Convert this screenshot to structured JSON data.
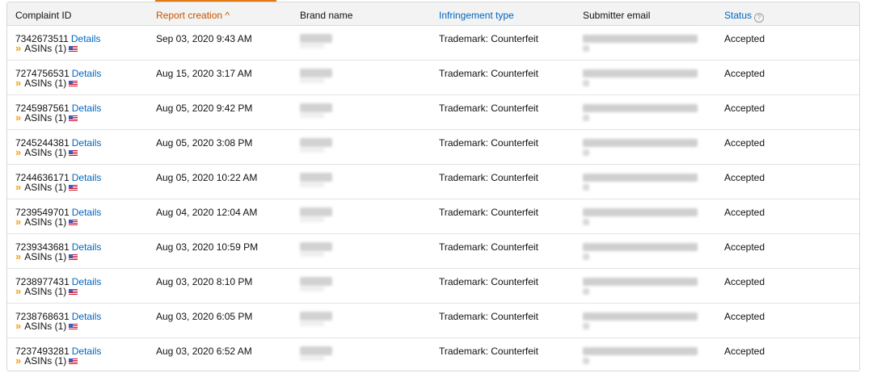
{
  "header": {
    "complaint_id": "Complaint ID",
    "report_creation": "Report creation ^",
    "brand_name": "Brand name",
    "infringement_type": "Infringement type",
    "submitter_email": "Submitter email",
    "status": "Status",
    "status_help": "?"
  },
  "details_label": "Details",
  "asin_label": "ASINs (1)",
  "rows": [
    {
      "id": "7342673511",
      "date": "Sep 03, 2020 9:43 AM",
      "type": "Trademark: Counterfeit",
      "status": "Accepted"
    },
    {
      "id": "7274756531",
      "date": "Aug 15, 2020 3:17 AM",
      "type": "Trademark: Counterfeit",
      "status": "Accepted"
    },
    {
      "id": "7245987561",
      "date": "Aug 05, 2020 9:42 PM",
      "type": "Trademark: Counterfeit",
      "status": "Accepted"
    },
    {
      "id": "7245244381",
      "date": "Aug 05, 2020 3:08 PM",
      "type": "Trademark: Counterfeit",
      "status": "Accepted"
    },
    {
      "id": "7244636171",
      "date": "Aug 05, 2020 10:22 AM",
      "type": "Trademark: Counterfeit",
      "status": "Accepted"
    },
    {
      "id": "7239549701",
      "date": "Aug 04, 2020 12:04 AM",
      "type": "Trademark: Counterfeit",
      "status": "Accepted"
    },
    {
      "id": "7239343681",
      "date": "Aug 03, 2020 10:59 PM",
      "type": "Trademark: Counterfeit",
      "status": "Accepted"
    },
    {
      "id": "7238977431",
      "date": "Aug 03, 2020 8:10 PM",
      "type": "Trademark: Counterfeit",
      "status": "Accepted"
    },
    {
      "id": "7238768631",
      "date": "Aug 03, 2020 6:05 PM",
      "type": "Trademark: Counterfeit",
      "status": "Accepted"
    },
    {
      "id": "7237493281",
      "date": "Aug 03, 2020 6:52 AM",
      "type": "Trademark: Counterfeit",
      "status": "Accepted"
    }
  ],
  "colors": {
    "link": "#0066c0",
    "sorted_header": "#c45500",
    "sort_underline": "#e47911",
    "chevron": "#f0a11a"
  },
  "icons": {
    "asin_expand": "double-chevron-right-icon",
    "marketplace_flag": "us-flag-icon",
    "status_help": "help-circle-icon"
  }
}
